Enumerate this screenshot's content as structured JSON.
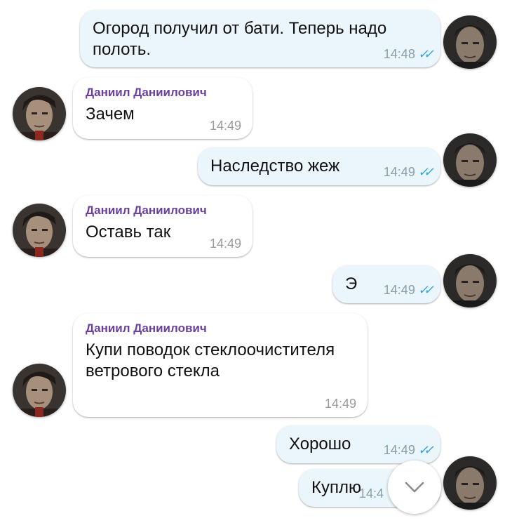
{
  "chat": {
    "contact_name": "Даниил Даниилович",
    "messages": [
      {
        "dir": "out",
        "text": "Огород получил от бати. Теперь надо полоть.",
        "time": "14:48",
        "read": true
      },
      {
        "dir": "in",
        "sender": "Даниил Даниилович",
        "text": "Зачем",
        "time": "14:49"
      },
      {
        "dir": "out",
        "text": "Наследство жеж",
        "time": "14:49",
        "read": true
      },
      {
        "dir": "in",
        "sender": "Даниил Даниилович",
        "text": "Оставь так",
        "time": "14:49"
      },
      {
        "dir": "out",
        "text": "Э",
        "time": "14:49",
        "read": true
      },
      {
        "dir": "in",
        "sender": "Даниил Даниилович",
        "text": "Купи поводок стеклоочистителя ветрового стекла",
        "time": "14:49"
      },
      {
        "dir": "out",
        "text": "Хорошо",
        "time": "14:49",
        "read": true
      },
      {
        "dir": "out",
        "text": "Куплю",
        "time": "14:4",
        "read": true
      }
    ],
    "read_ticks": "✓✓",
    "scroll_down_icon": "chevron-down-icon"
  },
  "colors": {
    "outgoing_bubble": "#eaf6fb",
    "incoming_bubble": "#ffffff",
    "sender_name": "#6b3f9e",
    "read_ticks": "#3aa2d8"
  }
}
